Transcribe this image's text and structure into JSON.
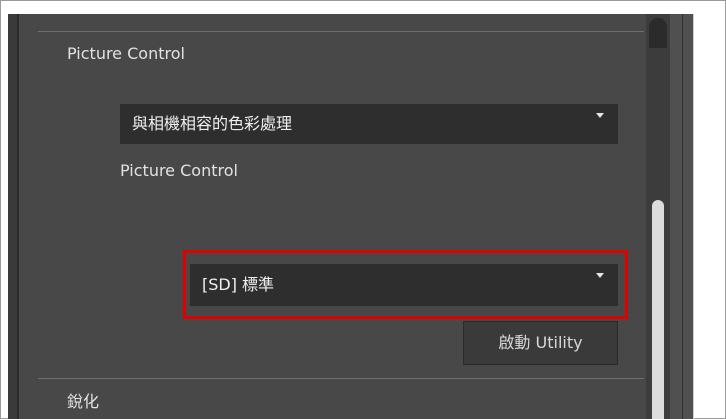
{
  "picture_control_section": {
    "title": "Picture Control",
    "dropdown_value": "與相機相容的色彩處理",
    "sub_label": "Picture Control",
    "preset_dropdown_value": "[SD] 標準",
    "launch_button_label": "啟動 Utility"
  },
  "sharpening_section": {
    "title": "銳化"
  },
  "colors": {
    "panel_background": "#484848",
    "dropdown_background": "#2e2e2e",
    "highlight_border": "#e00000",
    "text": "#e2e2e2"
  },
  "icons": {
    "dropdown_caret": "caret-down-icon"
  }
}
